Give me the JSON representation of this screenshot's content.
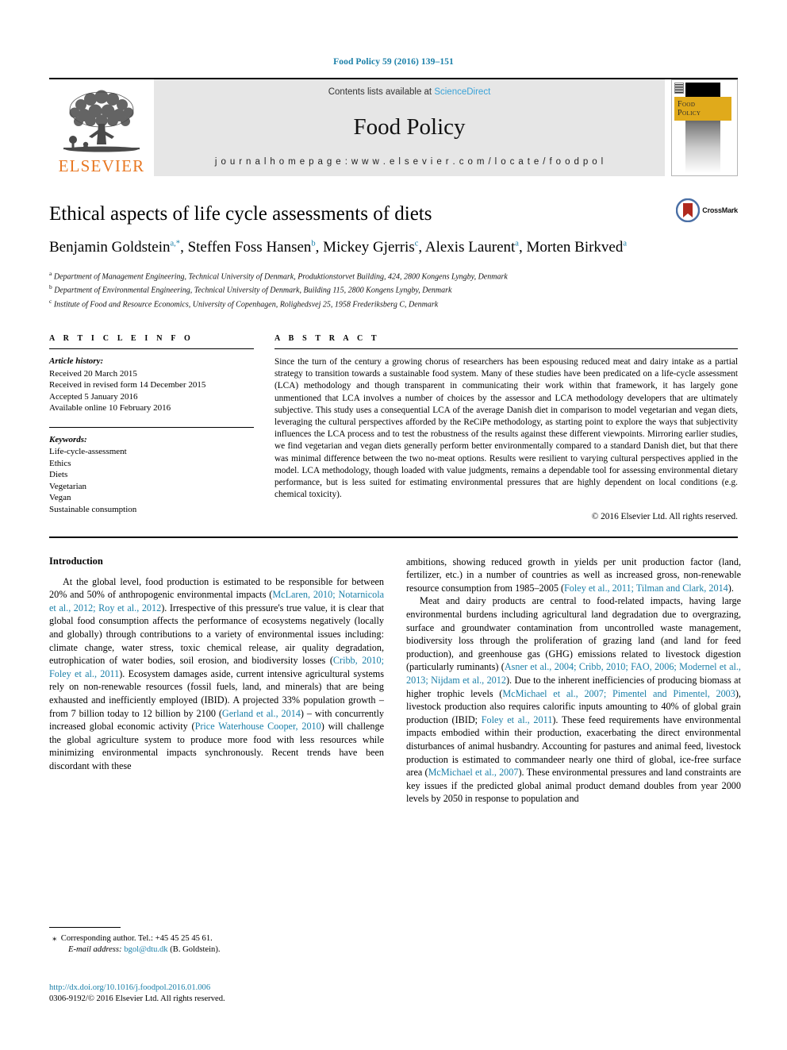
{
  "running_head": "Food Policy 59 (2016) 139–151",
  "masthead": {
    "contents_prefix": "Contents lists available at ",
    "sciencedirect": "ScienceDirect",
    "journal_name": "Food Policy",
    "homepage": "j o u r n a l   h o m e p a g e :   w w w . e l s e v i e r . c o m / l o c a t e / f o o d p o l",
    "publisher": "ELSEVIER",
    "cover_title_line1": "Food",
    "cover_title_line2": "Policy"
  },
  "article": {
    "title": "Ethical aspects of life cycle assessments of diets",
    "crossmark_label": "CrossMark",
    "authors": [
      {
        "name": "Benjamin Goldstein",
        "sup": "a,*"
      },
      {
        "name": "Steffen Foss Hansen",
        "sup": "b"
      },
      {
        "name": "Mickey Gjerris",
        "sup": "c"
      },
      {
        "name": "Alexis Laurent",
        "sup": "a"
      },
      {
        "name": "Morten Birkved",
        "sup": "a"
      }
    ],
    "affiliations": [
      {
        "mark": "a",
        "text": "Department of Management Engineering, Technical University of Denmark, Produktionstorvet Building, 424, 2800 Kongens Lyngby, Denmark"
      },
      {
        "mark": "b",
        "text": "Department of Environmental Engineering, Technical University of Denmark, Building 115, 2800 Kongens Lyngby, Denmark"
      },
      {
        "mark": "c",
        "text": "Institute of Food and Resource Economics, University of Copenhagen, Rolighedsvej 25, 1958 Frederiksberg C, Denmark"
      }
    ]
  },
  "article_info": {
    "heading": "A R T I C L E   I N F O",
    "history_label": "Article history:",
    "history": [
      "Received 20 March 2015",
      "Received in revised form 14 December 2015",
      "Accepted 5 January 2016",
      "Available online 10 February 2016"
    ],
    "keywords_label": "Keywords:",
    "keywords": [
      "Life-cycle-assessment",
      "Ethics",
      "Diets",
      "Vegetarian",
      "Vegan",
      "Sustainable consumption"
    ]
  },
  "abstract": {
    "heading": "A B S T R A C T",
    "text": "Since the turn of the century a growing chorus of researchers has been espousing reduced meat and dairy intake as a partial strategy to transition towards a sustainable food system. Many of these studies have been predicated on a life-cycle assessment (LCA) methodology and though transparent in communicating their work within that framework, it has largely gone unmentioned that LCA involves a number of choices by the assessor and LCA methodology developers that are ultimately subjective. This study uses a consequential LCA of the average Danish diet in comparison to model vegetarian and vegan diets, leveraging the cultural perspectives afforded by the ReCiPe methodology, as starting point to explore the ways that subjectivity influences the LCA process and to test the robustness of the results against these different viewpoints. Mirroring earlier studies, we find vegetarian and vegan diets generally perform better environmentally compared to a standard Danish diet, but that there was minimal difference between the two no-meat options. Results were resilient to varying cultural perspectives applied in the model. LCA methodology, though loaded with value judgments, remains a dependable tool for assessing environmental dietary performance, but is less suited for estimating environmental pressures that are highly dependent on local conditions (e.g. chemical toxicity).",
    "copyright": "© 2016 Elsevier Ltd. All rights reserved."
  },
  "introduction": {
    "heading": "Introduction",
    "left_paragraph_1_a": "At the global level, food production is estimated to be responsible for between 20% and 50% of anthropogenic environmental impacts (",
    "left_ref_1": "McLaren, 2010; Notarnicola et al., 2012; Roy et al., 2012",
    "left_paragraph_1_b": "). Irrespective of this pressure's true value, it is clear that global food consumption affects the performance of ecosystems negatively (locally and globally) through contributions to a variety of environmental issues including: climate change, water stress, toxic chemical release, air quality degradation, eutrophication of water bodies, soil erosion, and biodiversity losses (",
    "left_ref_2": "Cribb, 2010; Foley et al., 2011",
    "left_paragraph_1_c": "). Ecosystem damages aside, current intensive agricultural systems rely on non-renewable resources (fossil fuels, land, and minerals) that are being exhausted and inefficiently employed (IBID). A projected 33% population growth – from 7 billion today to 12 billion by 2100 (",
    "left_ref_3": "Gerland et al., 2014",
    "left_paragraph_1_d": ") – with concurrently increased global economic activity (",
    "left_ref_4": "Price Waterhouse Cooper, 2010",
    "left_paragraph_1_e": ") will challenge the global agriculture system to produce more food with less resources while minimizing environmental impacts synchronously. Recent trends have been discordant with these",
    "right_paragraph_1_a": "ambitions, showing reduced growth in yields per unit production factor (land, fertilizer, etc.) in a number of countries as well as increased gross, non-renewable resource consumption from 1985–2005 (",
    "right_ref_1": "Foley et al., 2011; Tilman and Clark, 2014",
    "right_paragraph_1_b": ").",
    "right_paragraph_2_a": "Meat and dairy products are central to food-related impacts, having large environmental burdens including agricultural land degradation due to overgrazing, surface and groundwater contamination from uncontrolled waste management, biodiversity loss through the proliferation of grazing land (and land for feed production), and greenhouse gas (GHG) emissions related to livestock digestion (particularly ruminants) (",
    "right_ref_2": "Asner et al., 2004; Cribb, 2010; FAO, 2006; Modernel et al., 2013; Nijdam et al., 2012",
    "right_paragraph_2_b": "). Due to the inherent inefficiencies of producing biomass at higher trophic levels (",
    "right_ref_3": "McMichael et al., 2007; Pimentel and Pimentel, 2003",
    "right_paragraph_2_c": "), livestock production also requires calorific inputs amounting to 40% of global grain production (IBID; ",
    "right_ref_4": "Foley et al., 2011",
    "right_paragraph_2_d": "). These feed requirements have environmental impacts embodied within their production, exacerbating the direct environmental disturbances of animal husbandry. Accounting for pastures and animal feed, livestock production is estimated to commandeer nearly one third of global, ice-free surface area (",
    "right_ref_5": "McMichael et al., 2007",
    "right_paragraph_2_e": "). These environmental pressures and land constraints are key issues if the predicted global animal product demand doubles from year 2000 levels by 2050 in response to population and"
  },
  "footnote": {
    "corresponding": "Corresponding author. Tel.: +45 45 25 45 61.",
    "email_label": "E-mail address:",
    "email": "bgol@dtu.dk",
    "email_suffix": "(B. Goldstein)."
  },
  "footer": {
    "doi": "http://dx.doi.org/10.1016/j.foodpol.2016.01.006",
    "issn_line": "0306-9192/© 2016 Elsevier Ltd. All rights reserved."
  },
  "colors": {
    "link": "#1a7fa8",
    "sciencedirect": "#3aa3d8",
    "elsevier_orange": "#E87722",
    "cover_gold": "#E0AA1B",
    "masthead_grey": "#e6e6e6"
  }
}
